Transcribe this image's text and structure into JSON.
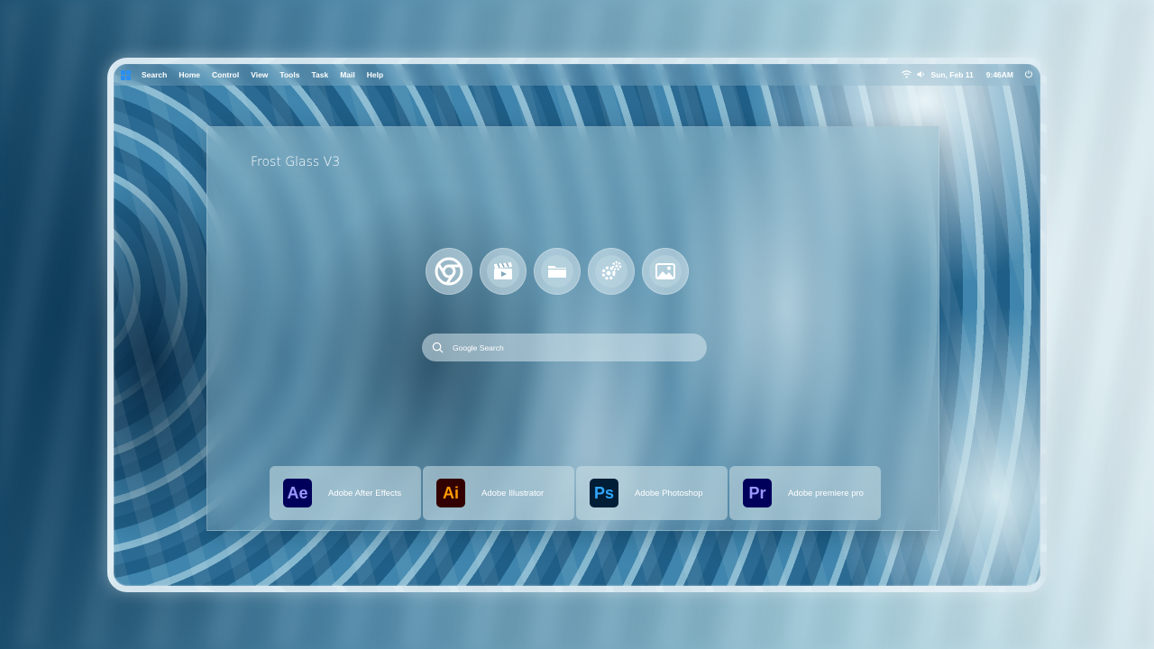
{
  "menubar": {
    "items": [
      "Search",
      "Home",
      "Control",
      "View",
      "Tools",
      "Task",
      "Mail",
      "Help"
    ],
    "date": "Sun, Feb 11",
    "time": "9:46AM",
    "icons": [
      "windows-logo-icon",
      "wifi-icon",
      "volume-icon",
      "power-icon"
    ]
  },
  "panel": {
    "title": "Frost Glass V3",
    "quick_launch": [
      "chrome-icon",
      "video-editor-icon",
      "folder-icon",
      "settings-icon",
      "photos-icon"
    ],
    "search_placeholder": "Google Search"
  },
  "apps": [
    {
      "abbr": "Ae",
      "label": "Adobe After Effects",
      "bg": "#00005b",
      "fg": "#9999ff"
    },
    {
      "abbr": "Ai",
      "label": "Adobe Illustrator",
      "bg": "#330000",
      "fg": "#ff9a00"
    },
    {
      "abbr": "Ps",
      "label": "Adobe Photoshop",
      "bg": "#001e36",
      "fg": "#31a8ff"
    },
    {
      "abbr": "Pr",
      "label": "Adobe premiere pro",
      "bg": "#00005b",
      "fg": "#9999ff"
    }
  ]
}
